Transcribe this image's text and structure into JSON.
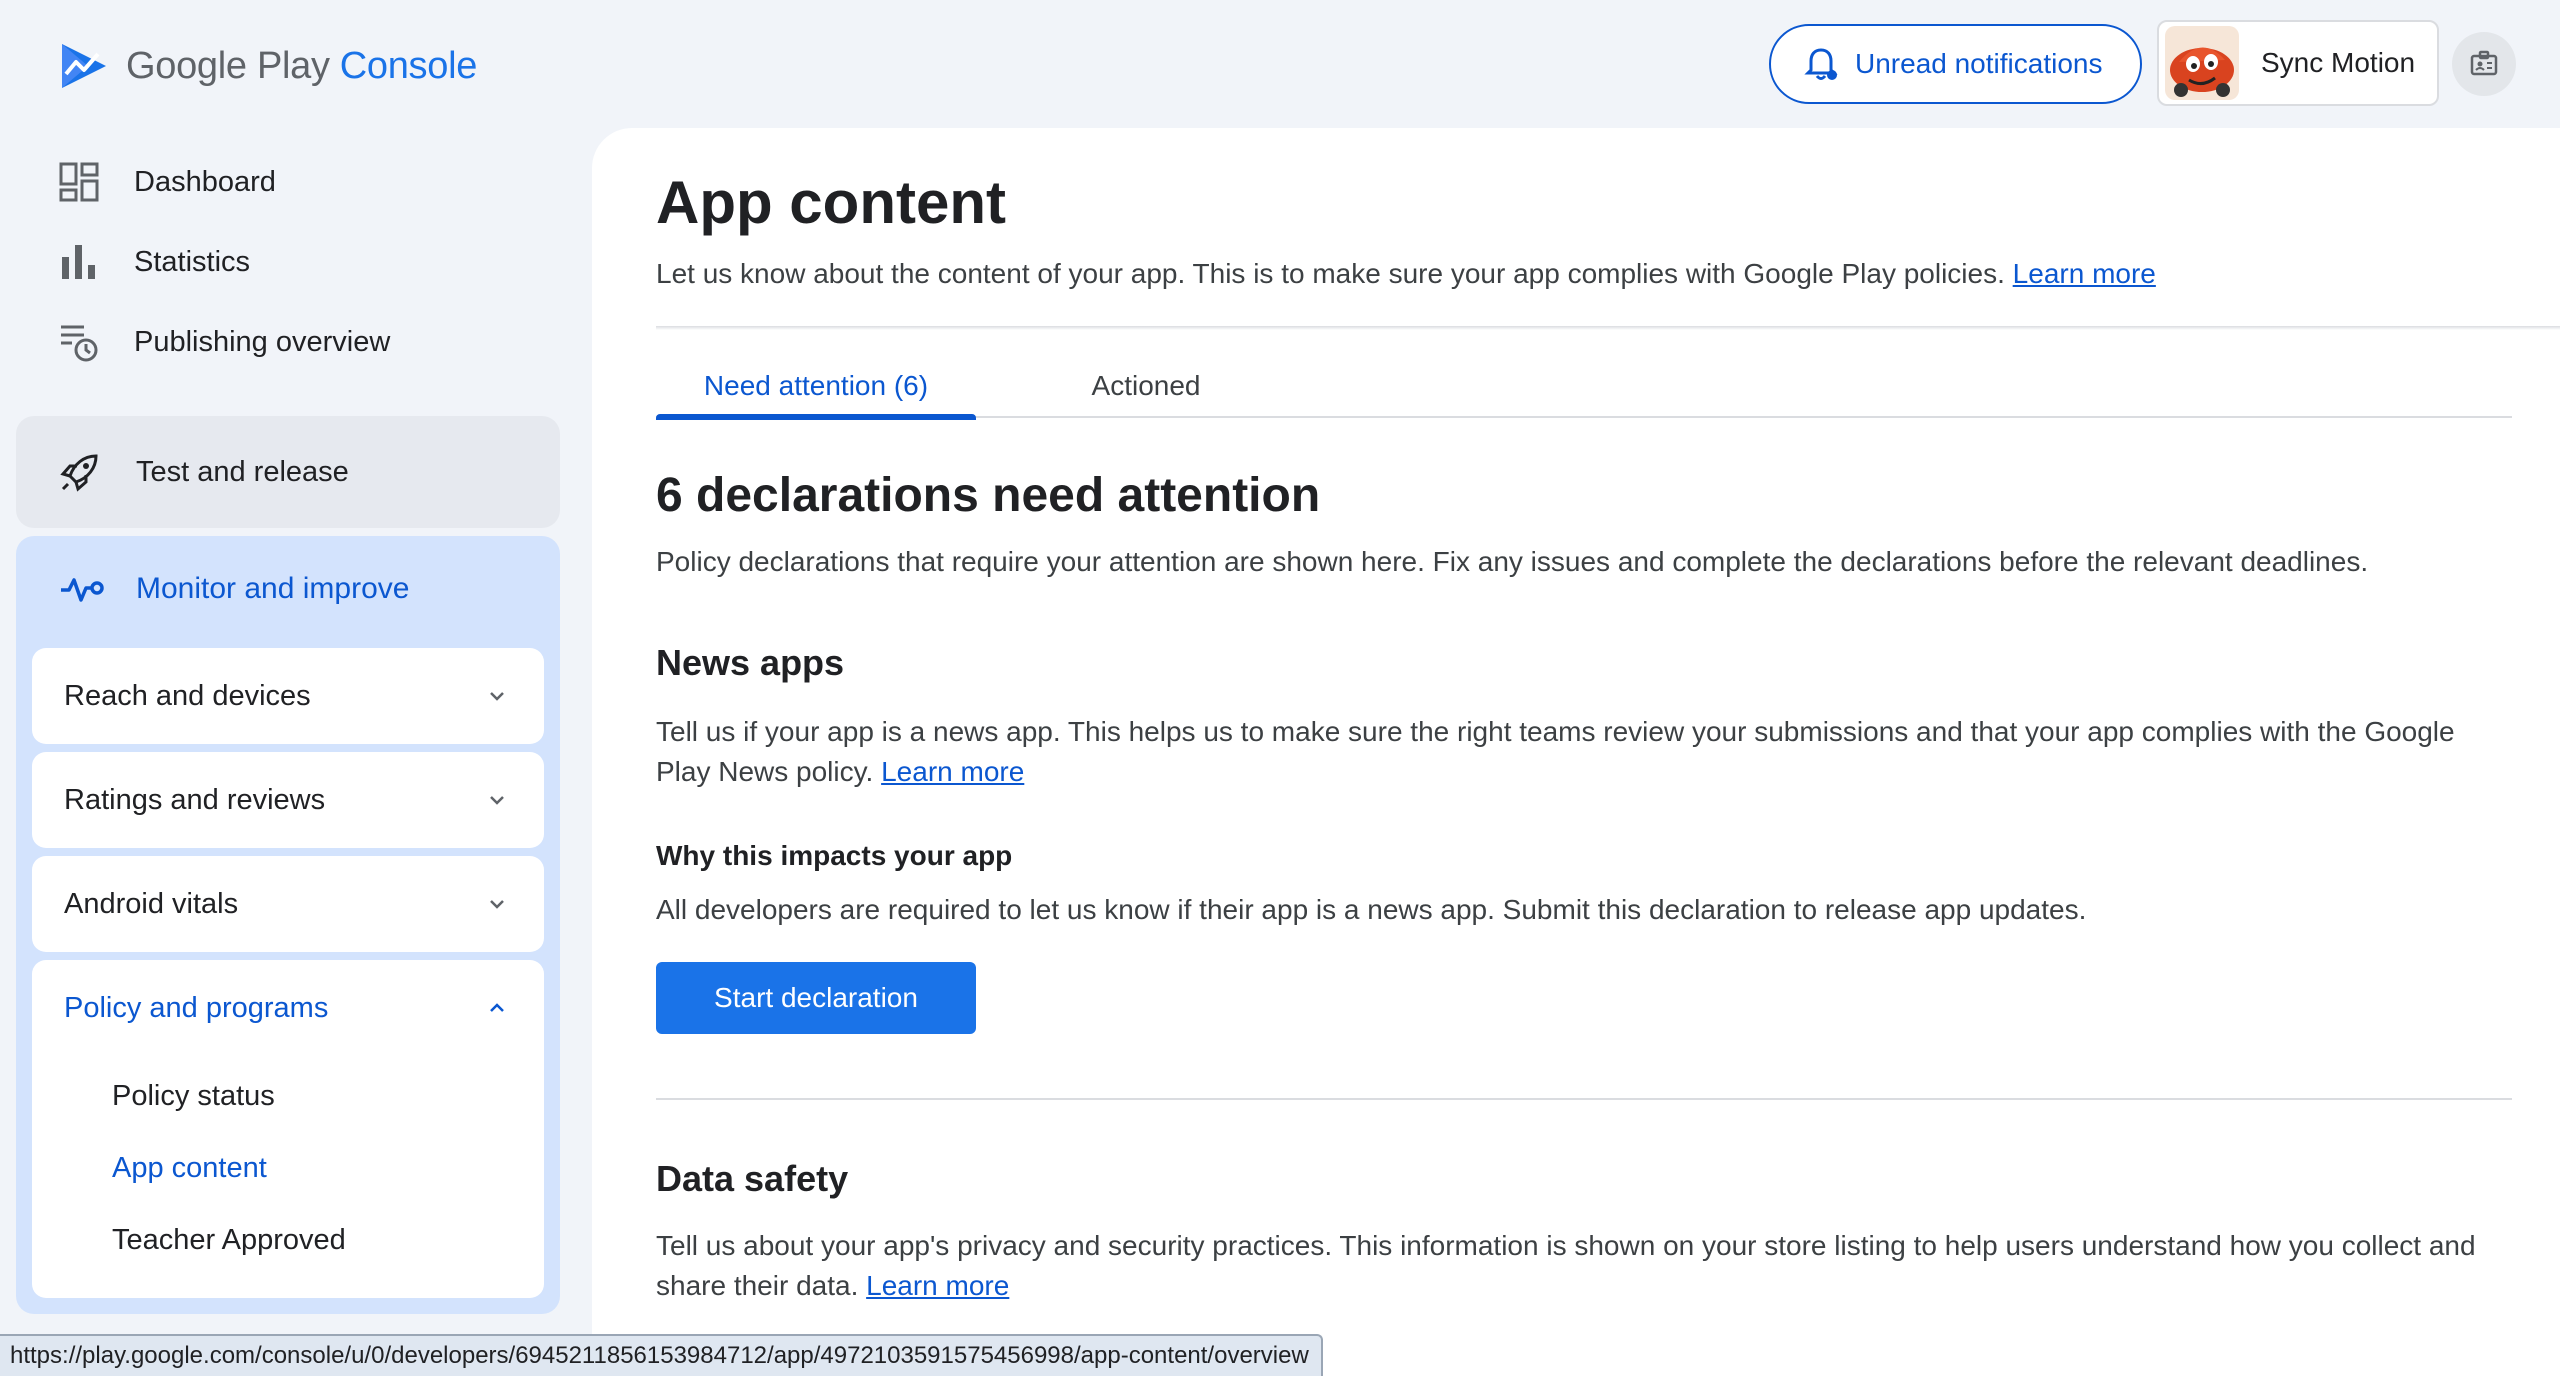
{
  "header": {
    "brand_google_play": "Google Play",
    "brand_console": "Console",
    "notifications_label": "Unread notifications",
    "account_name": "Sync Motion"
  },
  "sidebar": {
    "top_items": [
      {
        "label": "Dashboard",
        "icon": "dashboard-icon"
      },
      {
        "label": "Statistics",
        "icon": "bar-chart-icon"
      },
      {
        "label": "Publishing overview",
        "icon": "publishing-overview-icon"
      }
    ],
    "test_and_release": "Test and release",
    "monitor_and_improve": "Monitor and improve",
    "groups": [
      {
        "label": "Reach and devices",
        "expanded": false
      },
      {
        "label": "Ratings and reviews",
        "expanded": false
      },
      {
        "label": "Android vitals",
        "expanded": false
      },
      {
        "label": "Policy and programs",
        "expanded": true
      }
    ],
    "policy_items": [
      {
        "label": "Policy status",
        "active": false
      },
      {
        "label": "App content",
        "active": true
      },
      {
        "label": "Teacher Approved",
        "active": false
      }
    ]
  },
  "main": {
    "title": "App content",
    "subtitle": "Let us know about the content of your app. This is to make sure your app complies with Google Play policies.",
    "subtitle_link": "Learn more",
    "tabs": [
      {
        "label": "Need attention (6)",
        "active": true
      },
      {
        "label": "Actioned",
        "active": false
      }
    ],
    "section_title": "6 declarations need attention",
    "section_desc": "Policy declarations that require your attention are shown here. Fix any issues and complete the declarations before the relevant deadlines.",
    "news": {
      "title": "News apps",
      "desc": "Tell us if your app is a news app. This helps us to make sure the right teams review your submissions and that your app complies with the Google Play News policy.",
      "link": "Learn more",
      "impact_title": "Why this impacts your app",
      "impact_desc": "All developers are required to let us know if their app is a news app. Submit this declaration to release app updates.",
      "button": "Start declaration"
    },
    "data_safety": {
      "title": "Data safety",
      "desc": "Tell us about your app's privacy and security practices. This information is shown on your store listing to help users understand how you collect and share their data.",
      "link": "Learn more"
    }
  },
  "status_bar": {
    "url": "https://play.google.com/console/u/0/developers/6945211856153984712/app/4972103591575456998/app-content/overview"
  },
  "colors": {
    "accent": "#0b57d0",
    "button": "#1a73e8",
    "sidebar_active_bg": "#d3e3fd",
    "page_bg": "#f1f4f9"
  }
}
